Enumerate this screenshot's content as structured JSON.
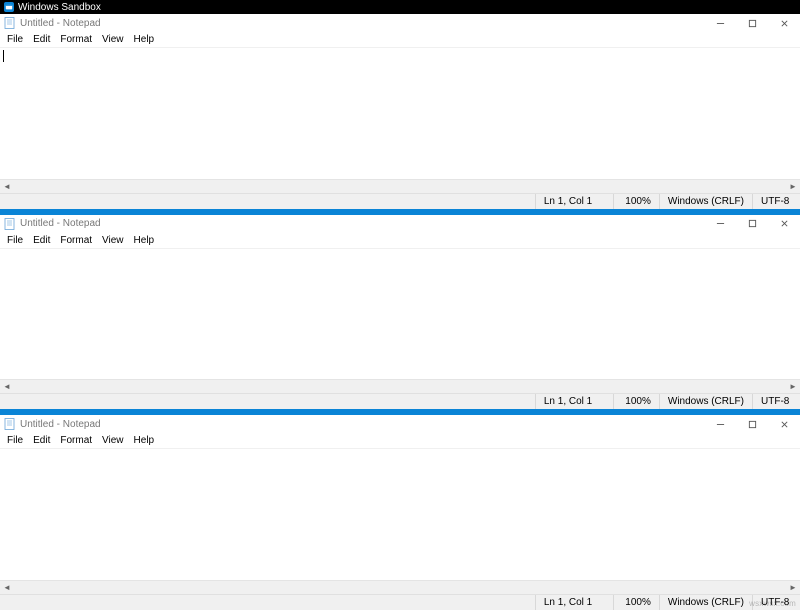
{
  "outer": {
    "title": "Windows Sandbox",
    "icon": "sandbox-icon"
  },
  "watermark": "wsxwsx.com",
  "notepads": [
    {
      "title": "Untitled - Notepad",
      "menu": {
        "file": "File",
        "edit": "Edit",
        "format": "Format",
        "view": "View",
        "help": "Help"
      },
      "has_caret": true,
      "status": {
        "lncol": "Ln 1, Col 1",
        "zoom": "100%",
        "eol": "Windows (CRLF)",
        "enc": "UTF-8"
      }
    },
    {
      "title": "Untitled - Notepad",
      "menu": {
        "file": "File",
        "edit": "Edit",
        "format": "Format",
        "view": "View",
        "help": "Help"
      },
      "has_caret": false,
      "status": {
        "lncol": "Ln 1, Col 1",
        "zoom": "100%",
        "eol": "Windows (CRLF)",
        "enc": "UTF-8"
      }
    },
    {
      "title": "Untitled - Notepad",
      "menu": {
        "file": "File",
        "edit": "Edit",
        "format": "Format",
        "view": "View",
        "help": "Help"
      },
      "has_caret": false,
      "status": {
        "lncol": "Ln 1, Col 1",
        "zoom": "100%",
        "eol": "Windows (CRLF)",
        "enc": "UTF-8"
      }
    }
  ]
}
